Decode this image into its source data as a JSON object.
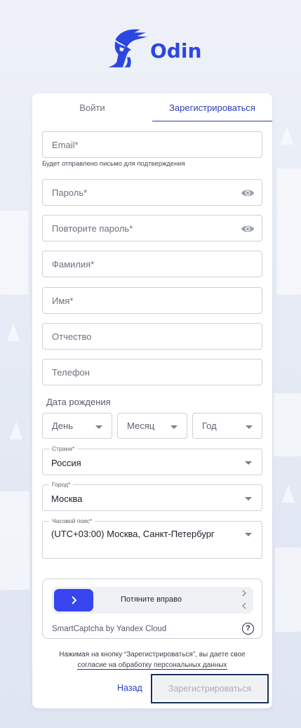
{
  "app": {
    "name": "Odin"
  },
  "tabs": {
    "login": "Войти",
    "register": "Зарегистрироваться"
  },
  "form": {
    "email_placeholder": "Email*",
    "email_hint": "Будет отправлено письмо для подтверждения",
    "password_placeholder": "Пароль*",
    "password_repeat_placeholder": "Повторите пароль*",
    "last_name_placeholder": "Фамилия*",
    "first_name_placeholder": "Имя*",
    "middle_name_placeholder": "Отчество",
    "phone_placeholder": "Телефон",
    "birthdate_label": "Дата рождения",
    "day_placeholder": "День",
    "month_placeholder": "Месяц",
    "year_placeholder": "Год",
    "country_label": "Страна*",
    "country_value": "Россия",
    "city_label": "Город*",
    "city_value": "Москва",
    "timezone_label": "Часовой пояс*",
    "timezone_value": "(UTC+03:00) Москва, Санкт-Петербург"
  },
  "captcha": {
    "slider_text": "Потяните вправо",
    "brand": "SmartCaptcha by Yandex Cloud",
    "help": "?"
  },
  "consent": {
    "text": "Нажимая на кнопку “Зарегистрироваться”, вы даете свое",
    "link": "согласие на обработку персональных данных"
  },
  "actions": {
    "back": "Назад",
    "register": "Зарегистрироваться"
  },
  "colors": {
    "accent": "#2c46e2",
    "slider": "#3645f0",
    "register_border": "#16305c"
  }
}
